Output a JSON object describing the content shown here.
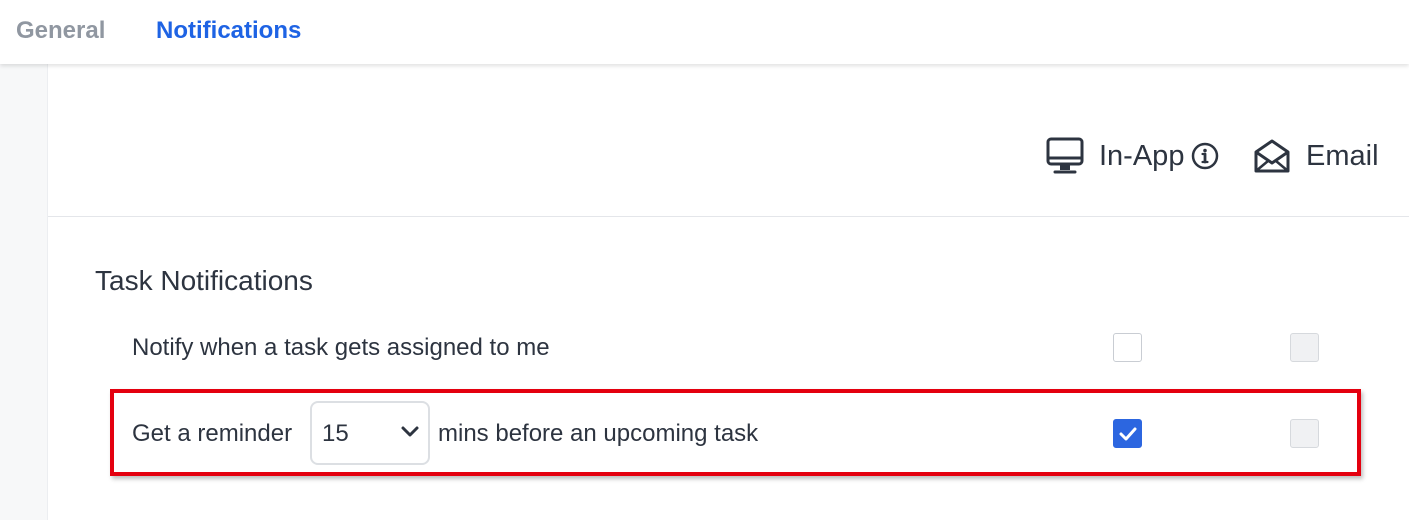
{
  "tabs": {
    "general": "General",
    "notifications": "Notifications",
    "active": "notifications"
  },
  "channels": {
    "in_app": {
      "label": "In-App",
      "icon": "monitor-icon",
      "info_icon": "info-icon"
    },
    "email": {
      "label": "Email",
      "icon": "envelope-open-icon"
    }
  },
  "section": {
    "title": "Task Notifications"
  },
  "rows": [
    {
      "text": "Notify when a task gets assigned to me",
      "in_app_checked": false,
      "email_checked": false,
      "email_disabled": true
    },
    {
      "text_before": "Get a reminder",
      "select_value": "15",
      "text_after": "mins before an upcoming task",
      "in_app_checked": true,
      "email_checked": false,
      "email_disabled": true,
      "highlighted": true
    }
  ],
  "colors": {
    "accent": "#2c66e0",
    "tab_active": "#1e63e4",
    "tab_inactive": "#9097a1",
    "highlight": "#e4000f",
    "text": "#2d3440"
  }
}
